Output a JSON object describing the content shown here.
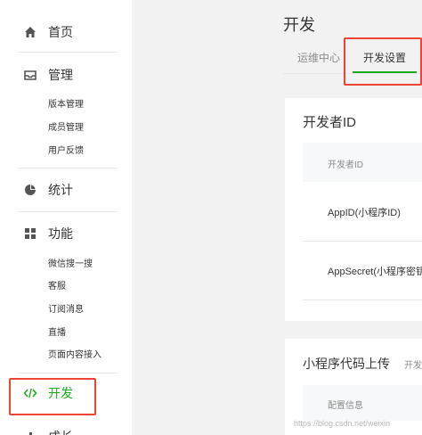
{
  "sidebar": {
    "home": {
      "label": "首页",
      "icon": "home-icon"
    },
    "manage": {
      "label": "管理",
      "icon": "inbox-icon",
      "items": [
        "版本管理",
        "成员管理",
        "用户反馈"
      ]
    },
    "stats": {
      "label": "统计",
      "icon": "pie-chart-icon"
    },
    "features": {
      "label": "功能",
      "icon": "grid-icon",
      "items": [
        "微信搜一搜",
        "客服",
        "订阅消息",
        "直播",
        "页面内容接入"
      ]
    },
    "dev": {
      "label": "开发",
      "icon": "code-icon",
      "color": "#1aad19"
    },
    "growth": {
      "label": "成长"
    }
  },
  "main": {
    "title": "开发",
    "tabs": [
      {
        "label": "运维中心",
        "active": false
      },
      {
        "label": "开发设置",
        "active": true
      }
    ],
    "developer_id": {
      "title": "开发者ID",
      "header": "开发者ID",
      "rows": [
        "AppID(小程序ID)",
        "AppSecret(小程序密钥)"
      ]
    },
    "code_upload": {
      "title": "小程序代码上传",
      "extra": "开发",
      "header": "配置信息"
    }
  },
  "watermark": "https://blog.csdn.net/weixin",
  "colors": {
    "accent": "#1aad19",
    "highlight": "#ee4433"
  }
}
